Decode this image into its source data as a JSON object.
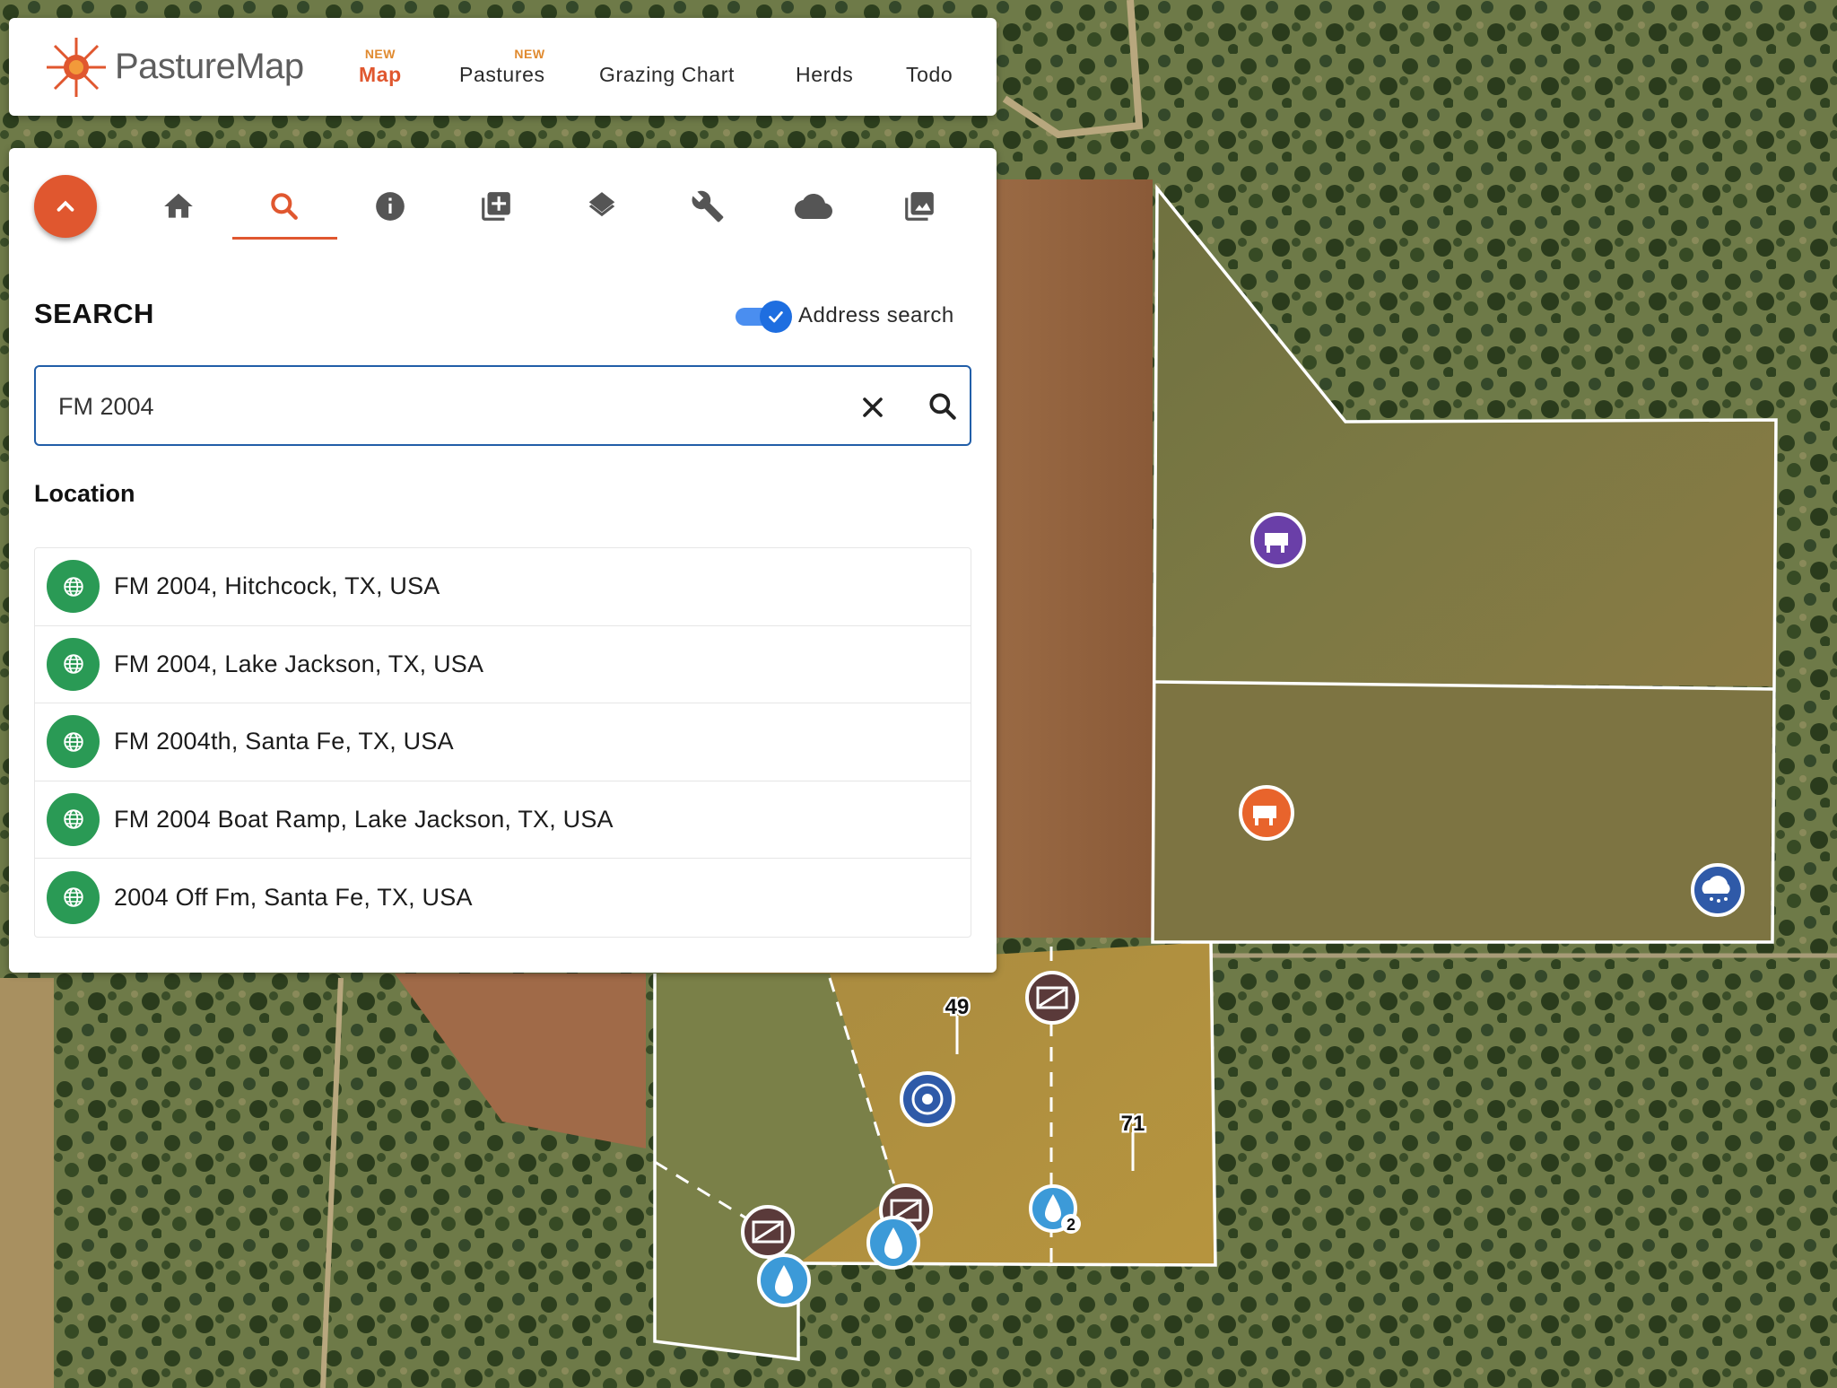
{
  "app": {
    "name": "PastureMap"
  },
  "nav": {
    "items": [
      {
        "label": "Map",
        "badge": "NEW",
        "active": true
      },
      {
        "label": "Pastures",
        "badge": "NEW",
        "active": false
      },
      {
        "label": "Grazing Chart",
        "badge": "",
        "active": false
      },
      {
        "label": "Herds",
        "badge": "",
        "active": false
      },
      {
        "label": "Todo",
        "badge": "",
        "active": false
      }
    ]
  },
  "toolbar": {
    "icons": [
      "chevron-up-icon",
      "home-icon",
      "search-icon",
      "info-icon",
      "add-layer-icon",
      "layers-icon",
      "wrench-icon",
      "cloud-icon",
      "photo-icon"
    ],
    "active": "search-icon"
  },
  "search": {
    "title": "SEARCH",
    "address_toggle_label": "Address search",
    "address_toggle_on": true,
    "query": "FM 2004",
    "section_label": "Location",
    "results": [
      "FM 2004, Hitchcock, TX, USA",
      "FM 2004, Lake Jackson, TX, USA",
      "FM 2004th, Santa Fe, TX, USA",
      "FM 2004 Boat Ramp, Lake Jackson, TX, USA",
      "2004 Off Fm, Santa Fe, TX, USA"
    ]
  },
  "map": {
    "labels": [
      "49",
      "71",
      "2"
    ],
    "markers": [
      "herd-icon-purple",
      "herd-icon-orange",
      "weather-station-icon",
      "gate-icon",
      "target-icon",
      "water-icon"
    ]
  },
  "colors": {
    "accent": "#e0572f",
    "badge": "#e08a2f",
    "search_border": "#215ea8",
    "toggle": "#1e6ee0",
    "globe": "#2a9a55",
    "herd_purple": "#6a3fa8",
    "herd_orange": "#e8642c",
    "water": "#3c9ad8",
    "gate": "#5a3a3a"
  }
}
